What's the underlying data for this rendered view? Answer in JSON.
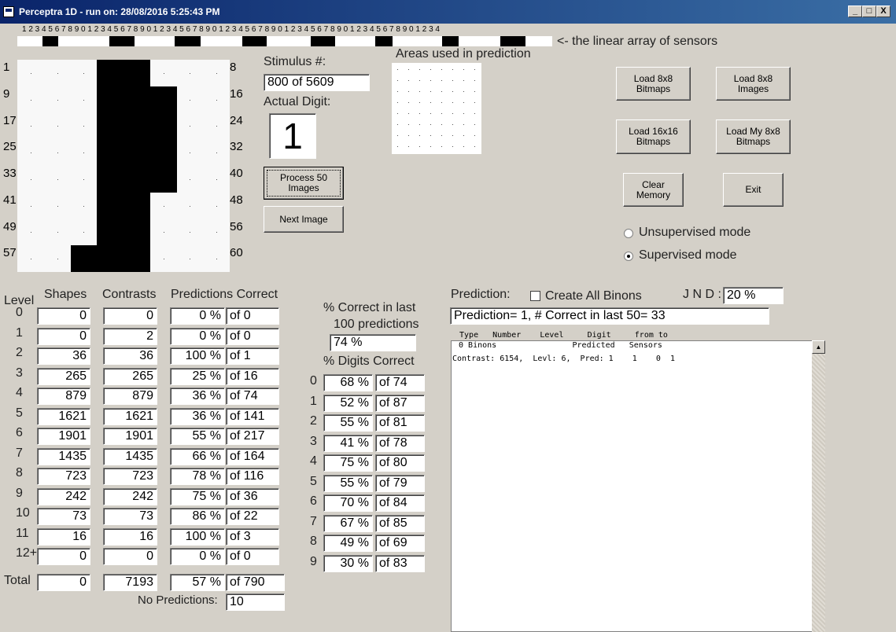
{
  "window": {
    "title": "Perceptra 1D - run on: 28/08/2016  5:25:43 PM",
    "minimize": "_",
    "maximize": "□",
    "close": "X"
  },
  "sensors": {
    "digits": "1 2 3 4 5 6 7 8 9 0 1 2 3 4 5 6 7 8 9 0 1 2 3 4 5 6 7 8 9 0 1 2 3 4 5 6 7 8 9 0 1 2 3 4 5 6 7 8 9 0 1 2 3 4 5 6 7 8 9 0 1 2 3 4",
    "caption": "<- the linear array of sensors"
  },
  "image": {
    "left_labels": [
      "1",
      "9",
      "17",
      "25",
      "33",
      "41",
      "49",
      "57"
    ],
    "right_labels": [
      "8",
      "16",
      "24",
      "32",
      "40",
      "48",
      "56",
      "60"
    ],
    "pixels": [
      [
        0,
        0,
        0,
        1,
        1,
        0,
        0,
        0
      ],
      [
        0,
        0,
        0,
        1,
        1,
        1,
        0,
        0
      ],
      [
        0,
        0,
        0,
        1,
        1,
        1,
        0,
        0
      ],
      [
        0,
        0,
        0,
        1,
        1,
        1,
        0,
        0
      ],
      [
        0,
        0,
        0,
        1,
        1,
        1,
        0,
        0
      ],
      [
        0,
        0,
        0,
        1,
        1,
        0,
        0,
        0
      ],
      [
        0,
        0,
        0,
        1,
        1,
        0,
        0,
        0
      ],
      [
        0,
        0,
        1,
        1,
        1,
        0,
        0,
        0
      ]
    ]
  },
  "stimulus": {
    "label": "Stimulus #:",
    "value": "800  of 5609"
  },
  "actual_digit": {
    "label": "Actual Digit:",
    "value": "1"
  },
  "areas": {
    "label": "Areas used in prediction"
  },
  "buttons": {
    "process": "Process 50 Images",
    "next": "Next Image",
    "load_8x8_bitmaps": "Load 8x8 Bitmaps",
    "load_8x8_images": "Load 8x8 Images",
    "load_16x16_bitmaps": "Load 16x16 Bitmaps",
    "load_my_8x8_bitmaps": "Load My 8x8 Bitmaps",
    "clear_memory": "Clear Memory",
    "exit": "Exit"
  },
  "modes": {
    "unsupervised": "Unsupervised mode",
    "supervised": "Supervised mode",
    "selected": "supervised"
  },
  "levels_table": {
    "headers": {
      "level": "Level",
      "shapes": "Shapes",
      "contrasts": "Contrasts",
      "predictions": "Predictions Correct"
    },
    "rows": [
      {
        "level": "0",
        "shapes": "0",
        "contrasts": "0",
        "pct": "0 %",
        "of": "of 0"
      },
      {
        "level": "1",
        "shapes": "0",
        "contrasts": "2",
        "pct": "0 %",
        "of": "of 0"
      },
      {
        "level": "2",
        "shapes": "36",
        "contrasts": "36",
        "pct": "100 %",
        "of": "of 1"
      },
      {
        "level": "3",
        "shapes": "265",
        "contrasts": "265",
        "pct": "25 %",
        "of": "of 16"
      },
      {
        "level": "4",
        "shapes": "879",
        "contrasts": "879",
        "pct": "36 %",
        "of": "of 74"
      },
      {
        "level": "5",
        "shapes": "1621",
        "contrasts": "1621",
        "pct": "36 %",
        "of": "of 141"
      },
      {
        "level": "6",
        "shapes": "1901",
        "contrasts": "1901",
        "pct": "55 %",
        "of": "of 217"
      },
      {
        "level": "7",
        "shapes": "1435",
        "contrasts": "1435",
        "pct": "66 %",
        "of": "of 164"
      },
      {
        "level": "8",
        "shapes": "723",
        "contrasts": "723",
        "pct": "78 %",
        "of": "of 116"
      },
      {
        "level": "9",
        "shapes": "242",
        "contrasts": "242",
        "pct": "75 %",
        "of": "of 36"
      },
      {
        "level": "10",
        "shapes": "73",
        "contrasts": "73",
        "pct": "86 %",
        "of": "of 22"
      },
      {
        "level": "11",
        "shapes": "16",
        "contrasts": "16",
        "pct": "100 %",
        "of": "of 3"
      },
      {
        "level": "12+",
        "shapes": "0",
        "contrasts": "0",
        "pct": "0 %",
        "of": "of 0"
      }
    ],
    "total": {
      "label": "Total",
      "shapes": "0",
      "contrasts": "7193",
      "pct": "57 %",
      "of": "of 790"
    },
    "no_predictions": {
      "label": "No Predictions:",
      "value": "10"
    }
  },
  "recent": {
    "label_line1": "% Correct in last",
    "label_line2": "100 predictions",
    "value": "74 %"
  },
  "digits_table": {
    "label": "% Digits Correct",
    "rows": [
      {
        "digit": "0",
        "pct": "68 %",
        "of": "of 74"
      },
      {
        "digit": "1",
        "pct": "52 %",
        "of": "of 87"
      },
      {
        "digit": "2",
        "pct": "55 %",
        "of": "of 81"
      },
      {
        "digit": "3",
        "pct": "41 %",
        "of": "of 78"
      },
      {
        "digit": "4",
        "pct": "75 %",
        "of": "of 80"
      },
      {
        "digit": "5",
        "pct": "55 %",
        "of": "of 79"
      },
      {
        "digit": "6",
        "pct": "70 %",
        "of": "of 84"
      },
      {
        "digit": "7",
        "pct": "67 %",
        "of": "of 85"
      },
      {
        "digit": "8",
        "pct": "49 %",
        "of": "of 69"
      },
      {
        "digit": "9",
        "pct": "30 %",
        "of": "of 83"
      }
    ]
  },
  "prediction": {
    "label": "Prediction:",
    "create_all_binons": "Create All Binons",
    "jnd_label": "J N D :",
    "jnd_value": "20 %",
    "result": "Prediction= 1, # Correct in last 50= 33"
  },
  "list": {
    "header": " Type   Number    Level     Digit     from to",
    "subheader": " 0 Binons                Predicted   Sensors",
    "lines": [
      "Contrast: 6154,  Levl: 6,  Pred: 1    1    0  1"
    ]
  }
}
